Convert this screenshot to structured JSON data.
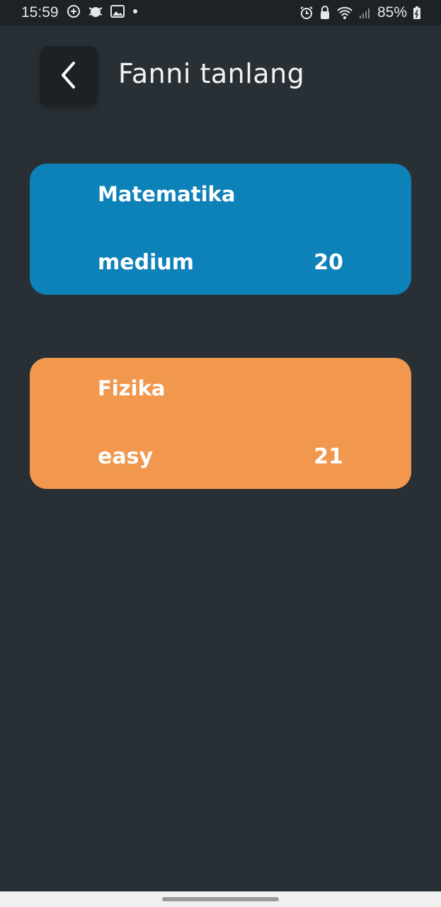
{
  "status_bar": {
    "time": "15:59",
    "battery": "85%"
  },
  "header": {
    "title": "Fanni tanlang"
  },
  "subjects": [
    {
      "name": "Matematika",
      "level": "medium",
      "count": "20",
      "color": "#0d82b8"
    },
    {
      "name": "Fizika",
      "level": "easy",
      "count": "21",
      "color": "#f2974e"
    }
  ],
  "colors": {
    "background": "#293035",
    "back_button": "#1c2125"
  }
}
